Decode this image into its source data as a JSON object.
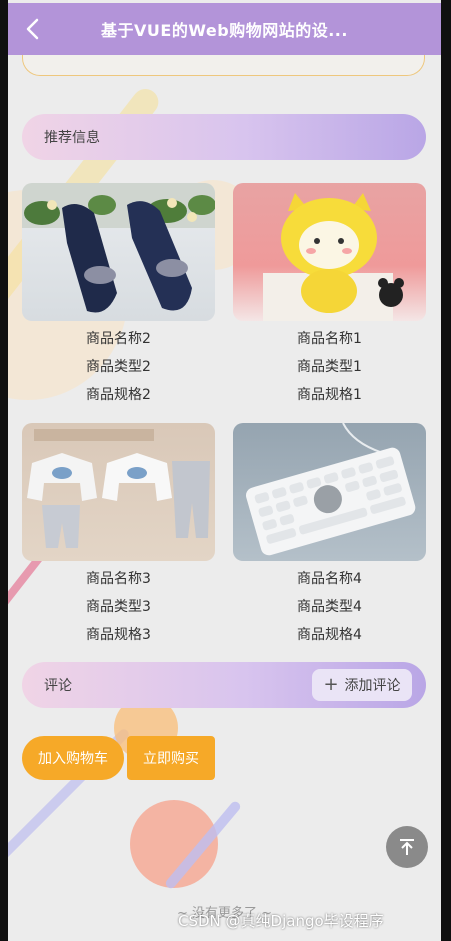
{
  "header": {
    "title": "基于VUE的Web购物网站的设..."
  },
  "recommend": {
    "title": "推荐信息"
  },
  "products": [
    {
      "name": "商品名称2",
      "type": "商品类型2",
      "spec": "商品规格2",
      "image": "navy-shoes"
    },
    {
      "name": "商品名称1",
      "type": "商品类型1",
      "spec": "商品规格1",
      "image": "yellow-plush-toy"
    },
    {
      "name": "商品名称3",
      "type": "商品类型3",
      "spec": "商品规格3",
      "image": "kids-clothes"
    },
    {
      "name": "商品名称4",
      "type": "商品类型4",
      "spec": "商品规格4",
      "image": "white-keyboard"
    }
  ],
  "comment": {
    "title": "评论",
    "add_label": "添加评论"
  },
  "actions": {
    "cart_label": "加入购物车",
    "buy_label": "立即购买"
  },
  "footer": {
    "no_more": "~ 没有更多了 ~",
    "watermark": "CSDN @真纯Django毕设程序"
  },
  "colors": {
    "header": "#b394d9",
    "accent_orange": "#f6a928"
  }
}
